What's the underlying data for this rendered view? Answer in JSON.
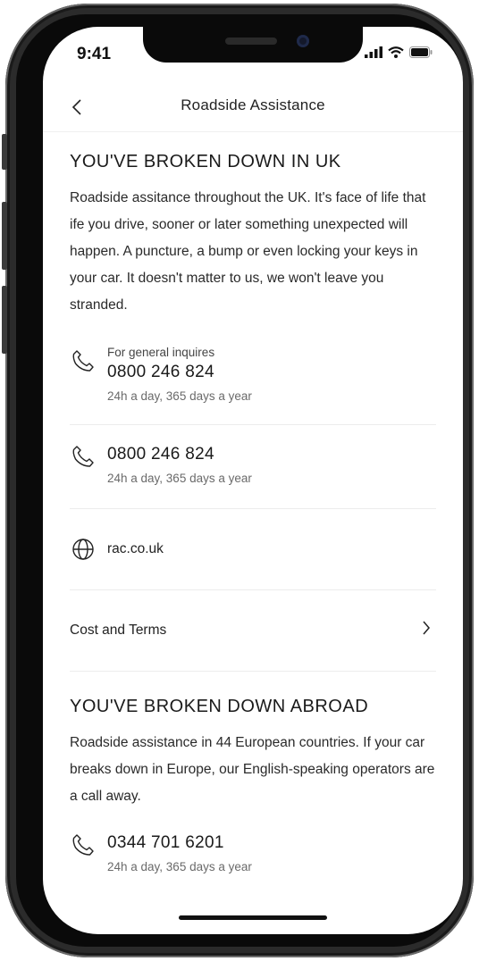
{
  "status_bar": {
    "time": "9:41"
  },
  "nav": {
    "title": "Roadside Assistance"
  },
  "uk_section": {
    "heading": "YOU'VE BROKEN DOWN IN UK",
    "body": "Roadside assitance throughout the UK. It's face of life that ife you drive, sooner or later something unexpected will happen. A puncture, a bump or even locking your keys in your car. It doesn't matter to us, we won't leave you stranded.",
    "contacts": [
      {
        "sub": "For general inquires",
        "number": "0800 246 824",
        "hours": "24h a day, 365 days a year"
      },
      {
        "number": "0800 246 824",
        "hours": "24h a day, 365 days a year"
      }
    ],
    "website": "rac.co.uk",
    "cost_terms_label": "Cost and Terms"
  },
  "abroad_section": {
    "heading": "YOU'VE BROKEN DOWN ABROAD",
    "body": "Roadside assistance in 44 European countries. If your car breaks down in Europe, our English-speaking operators are a call away.",
    "contact": {
      "number": "0344 701 6201",
      "hours": "24h a day, 365 days a year"
    }
  },
  "icons": [
    "back-chevron-icon",
    "phone-icon",
    "globe-icon",
    "chevron-right-icon",
    "signal-icon",
    "wifi-icon",
    "battery-icon"
  ],
  "colors": {
    "text": "#1a1a1a",
    "muted": "#6a6a6a",
    "divider": "#ececec",
    "background": "#ffffff"
  }
}
